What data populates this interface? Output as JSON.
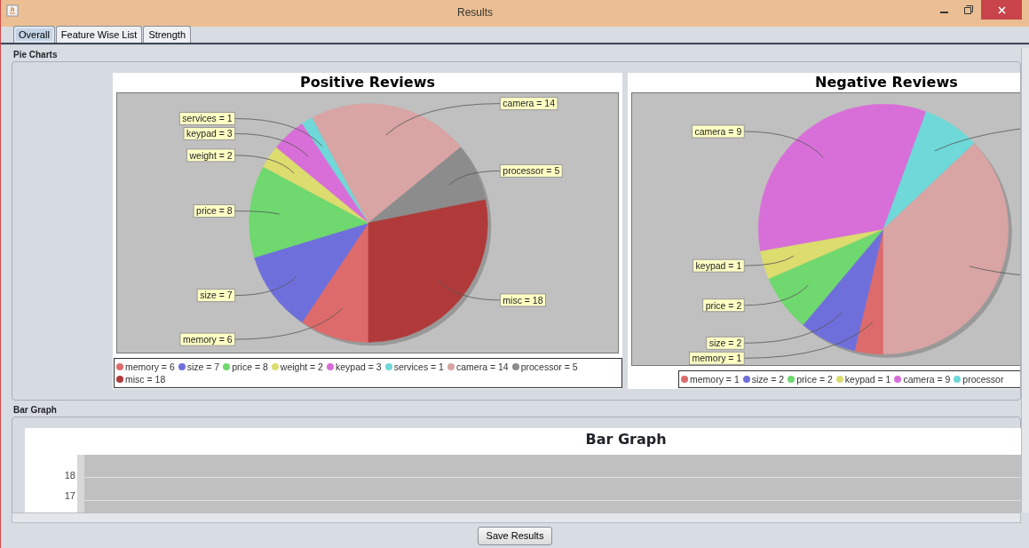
{
  "window": {
    "title": "Results"
  },
  "tabs": [
    {
      "label": "Overall",
      "selected": true
    },
    {
      "label": "Feature Wise List",
      "selected": false
    },
    {
      "label": "Strength",
      "selected": false
    }
  ],
  "pie_section": {
    "title": "Pie Charts",
    "charts": [
      {
        "chart_data": {
          "type": "pie",
          "title": "Positive Reviews",
          "categories": [
            "memory = 6",
            "size = 7",
            "price = 8",
            "weight = 2",
            "keypad = 3",
            "services = 1",
            "camera = 14",
            "processor = 5",
            "misc = 18"
          ],
          "values": [
            6,
            7,
            8,
            2,
            3,
            1,
            14,
            5,
            18
          ],
          "colors": [
            "#dd6b6b",
            "#6f6fdc",
            "#6fd86f",
            "#dcdc6f",
            "#d86fd8",
            "#6fd8d8",
            "#d8a4a4",
            "#8c8c8c",
            "#b03a3a"
          ]
        },
        "legend": [
          {
            "label": "memory = 6",
            "color": "#dd6b6b"
          },
          {
            "label": "size = 7",
            "color": "#6f6fdc"
          },
          {
            "label": "price = 8",
            "color": "#6fd86f"
          },
          {
            "label": "weight = 2",
            "color": "#dcdc6f"
          },
          {
            "label": "keypad = 3",
            "color": "#d86fd8"
          },
          {
            "label": "services = 1",
            "color": "#6fd8d8"
          },
          {
            "label": "camera = 14",
            "color": "#d8a4a4"
          },
          {
            "label": "processor = 5",
            "color": "#8c8c8c"
          },
          {
            "label": "misc = 18",
            "color": "#b03a3a"
          }
        ]
      },
      {
        "chart_data": {
          "type": "pie",
          "title": "Negative Reviews",
          "categories": [
            "memory = 1",
            "size = 2",
            "price = 2",
            "keypad = 1",
            "camera = 9",
            null,
            null
          ],
          "values": [
            1,
            2,
            2,
            1,
            9,
            2,
            10
          ],
          "colors": [
            "#dd6b6b",
            "#6f6fdc",
            "#6fd86f",
            "#dcdc6f",
            "#d86fd8",
            "#6fd8d8",
            "#d8a4a4"
          ]
        },
        "legend": [
          {
            "label": "memory = 1",
            "color": "#dd6b6b"
          },
          {
            "label": "size = 2",
            "color": "#6f6fdc"
          },
          {
            "label": "price = 2",
            "color": "#6fd86f"
          },
          {
            "label": "keypad = 1",
            "color": "#dcdc6f"
          },
          {
            "label": "camera = 9",
            "color": "#d86fd8"
          },
          {
            "label": "processor",
            "color": "#6fd8d8"
          }
        ]
      }
    ]
  },
  "bar_section": {
    "title": "Bar Graph",
    "chart_title": "Bar Graph",
    "y_ticks": [
      "18",
      "17"
    ]
  },
  "buttons": [
    {
      "label": "Save Results"
    }
  ]
}
